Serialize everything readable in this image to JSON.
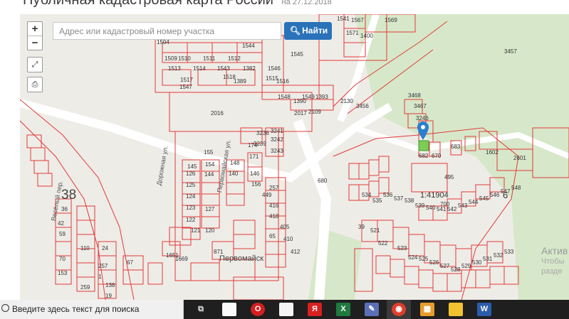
{
  "header": {
    "title": "Публичная кадастровая карта России",
    "date": "на 27.12.2018"
  },
  "map": {
    "search_placeholder": "Адрес или кадастровый номер участка",
    "search_button": "Найти",
    "zoom_in": "+",
    "zoom_out": "−",
    "area_label_38": "38",
    "quarter_label": "1:41904",
    "quarter_small": "6",
    "settlement": "Первомайск",
    "street_1": "Дорожная ул.",
    "street_2": "Первомайская ул.",
    "street_3": "Весёлый пер.",
    "parcel_labels": [
      "1541",
      "1567",
      "1569",
      "1571",
      "1400",
      "1504",
      "1509",
      "1510",
      "1511",
      "1512",
      "1513",
      "1514",
      "1543",
      "1382",
      "1544",
      "1545",
      "1546",
      "1515",
      "1516",
      "1517",
      "1518",
      "1389",
      "1547",
      "1548",
      "1549",
      "1393",
      "1390",
      "2016",
      "2017",
      "2109",
      "2130",
      "3456",
      "3457",
      "3468",
      "3467",
      "3246",
      "680",
      "682",
      "670",
      "683",
      "2601",
      "495",
      "700",
      "1602",
      "3236",
      "3239",
      "3241",
      "3242",
      "3243",
      "174",
      "155",
      "154",
      "145",
      "148",
      "126",
      "125",
      "144",
      "140",
      "124",
      "123",
      "122",
      "127",
      "121",
      "120",
      "146",
      "171",
      "156",
      "257",
      "449",
      "416",
      "418",
      "1651",
      "1669",
      "871",
      "412",
      "410",
      "405",
      "65",
      "24",
      "36",
      "42",
      "59",
      "70",
      "110",
      "153",
      "257",
      "259",
      "1",
      "67",
      "138",
      "19",
      "39",
      "521",
      "522",
      "523",
      "524",
      "525",
      "526",
      "527",
      "528",
      "529",
      "530",
      "531",
      "532",
      "533",
      "534",
      "535",
      "536",
      "537",
      "538",
      "539",
      "540",
      "541",
      "542",
      "543",
      "544",
      "545",
      "546",
      "547",
      "548"
    ],
    "map_colors": {
      "background": "#eeece7",
      "parcel_line": "#e23a3a",
      "forest": "#cfe6c4",
      "selected": "#7ccc55",
      "marker": "#2a7fcf"
    }
  },
  "watermark": {
    "line1": "Актив",
    "line2": "Чтобы",
    "line3": "разде"
  },
  "taskbar": {
    "search_text": "Введите здесь текст для поиска",
    "apps": [
      "task-view",
      "file",
      "opera",
      "document",
      "yandex",
      "excel",
      "paint",
      "chrome",
      "tablet",
      "explorer",
      "word"
    ]
  }
}
